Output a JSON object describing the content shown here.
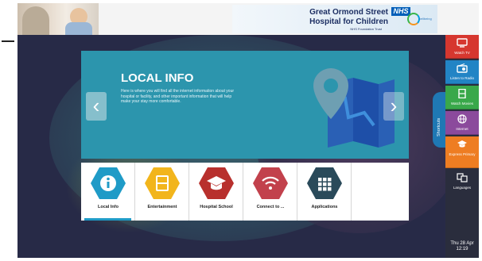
{
  "header": {
    "org_line1": "Great Ormond Street",
    "org_line2": "Hospital for Children",
    "org_line3": "NHS Foundation Trust",
    "nhs_logo": "NHS",
    "partner_logo_text": "wellbeing"
  },
  "banner": {
    "title": "LOCAL INFO",
    "description": "Here is where you will find all the internet information about your hospital or facility, and other important information that will help make your stay more comfortable.",
    "prev_glyph": "‹",
    "next_glyph": "›",
    "map_icon": "location-pin-map-icon"
  },
  "tiles": [
    {
      "label": "Local Info",
      "icon": "info-icon",
      "color": "#1f9bc7",
      "active": true
    },
    {
      "label": "Entertainment",
      "icon": "film-icon",
      "color": "#f2b51c",
      "active": false
    },
    {
      "label": "Hospital School",
      "icon": "graduation-cap-icon",
      "color": "#b8302d",
      "active": false
    },
    {
      "label": "Connect to ...",
      "icon": "wifi-icon",
      "color": "#c2414c",
      "active": false
    },
    {
      "label": "Applications",
      "icon": "grid-icon",
      "color": "#2a4a5a",
      "active": false
    }
  ],
  "shortcuts_tab": "Shortcuts",
  "rail": [
    {
      "label": "Watch TV",
      "icon": "tv-icon",
      "color": "#d6372f"
    },
    {
      "label": "Listen to Radio",
      "icon": "radio-icon",
      "color": "#2284c5"
    },
    {
      "label": "Watch Movies",
      "icon": "film-icon",
      "color": "#39a84a"
    },
    {
      "label": "Internet",
      "icon": "globe-icon",
      "color": "#8b4a9c"
    },
    {
      "label": "Express Primary",
      "icon": "graduation-cap-icon",
      "color": "#ee7d22"
    },
    {
      "label": "Languages",
      "icon": "language-icon",
      "color": "#2a2d3d"
    }
  ],
  "clock": {
    "date": "Thu 28 Apr",
    "time": "12:19"
  }
}
